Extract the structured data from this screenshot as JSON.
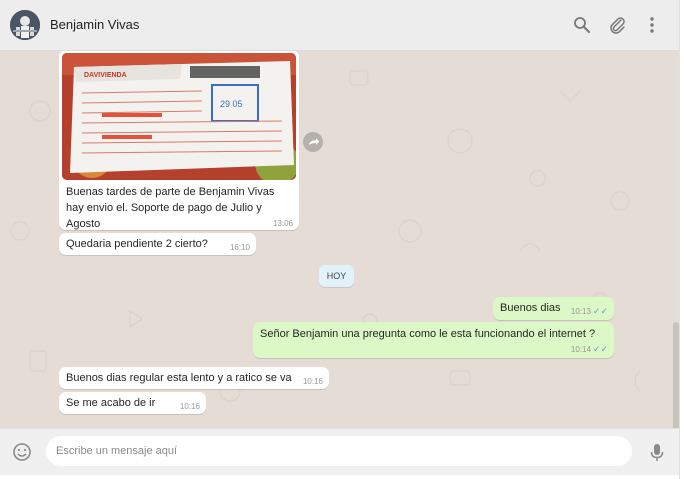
{
  "header": {
    "contact_name": "Benjamin Vivas",
    "icons": [
      "search-icon",
      "attach-icon",
      "menu-icon"
    ]
  },
  "messages": [
    {
      "direction": "incoming",
      "image": "document photo (Davivienda payment receipt)",
      "text": "Buenas tardes de parte de Benjamin Vivas hay envio el. Soporte de pago de Julio y Agosto",
      "time": "13:06"
    },
    {
      "direction": "incoming",
      "text": "Quedaria pendiente 2 cierto?",
      "time": "16:10"
    },
    {
      "direction": "outgoing",
      "text": "Buenos dias",
      "time": "10:13",
      "status": "read"
    },
    {
      "direction": "outgoing",
      "text": "Señor Benjamin una pregunta como le esta funcionando el internet ?",
      "time": "10:14",
      "status": "read"
    },
    {
      "direction": "incoming",
      "text": "Buenos dias regular esta lento y a ratico se va",
      "time": "10:16"
    },
    {
      "direction": "incoming",
      "text": "Se me acabo de ir",
      "time": "10:16"
    }
  ],
  "day_separator": "HOY",
  "composer": {
    "placeholder": "Escribe un mensaje aquí",
    "icons": [
      "emoji-icon",
      "microphone-icon"
    ]
  },
  "colors": {
    "header_bg": "#ededed",
    "chat_bg": "#e5ddd5",
    "incoming_bubble": "#ffffff",
    "outgoing_bubble": "#dcf8c6",
    "read_ticks": "#6b9bc0"
  }
}
